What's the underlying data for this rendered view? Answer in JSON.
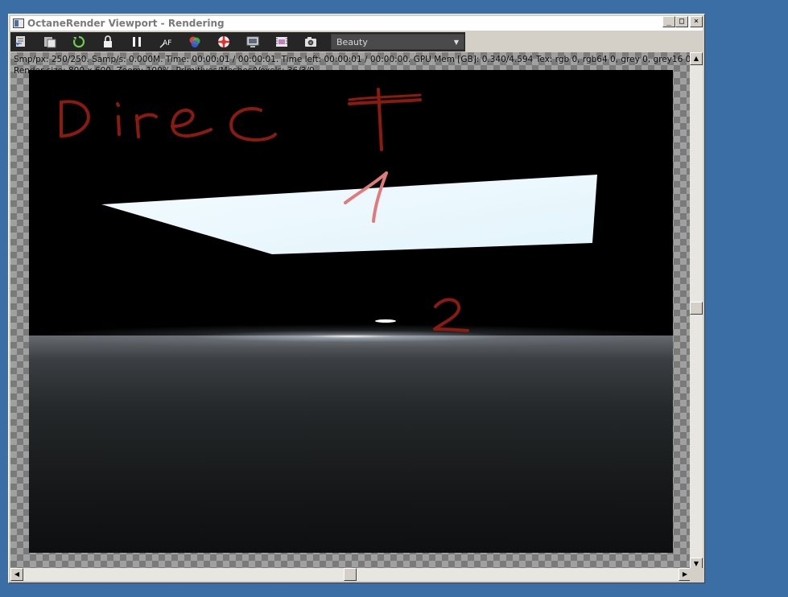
{
  "window": {
    "title": "OctaneRender Viewport - Rendering",
    "minimize_glyph": "_",
    "maximize_glyph": "□",
    "close_glyph": "×"
  },
  "toolbar": {
    "icons": [
      "recenter-view-icon",
      "copy-to-clipboard-icon",
      "restart-render-icon",
      "lock-viewport-icon",
      "pause-render-icon",
      "auto-focus-icon",
      "color-picker-icon",
      "clear-region-icon",
      "viewport-resolution-icon",
      "film-region-icon",
      "camera-snapshot-icon"
    ],
    "af_label": "AF",
    "render_pass": {
      "selected": "Beauty"
    }
  },
  "status": {
    "line1": "Smp/px: 250/250.    Samp/s: 0.000M.    Time: 00:00:01 / 00:00:01.    Time left: 00:00:01 / 00:00:00.    GPU Mem [GB]: 0.340/4.594    Tex: rgb 0, rgb64 0, grey 0, grey16 0.",
    "line2": "Render size: 800 x 600.    Zoom: 100%.    Primitives/Meshes/Voxels: 36/3/0"
  },
  "colors": {
    "desktop": "#3a6ea5",
    "annotation": "#8b1a10",
    "annotation_light": "#e06a6a"
  }
}
